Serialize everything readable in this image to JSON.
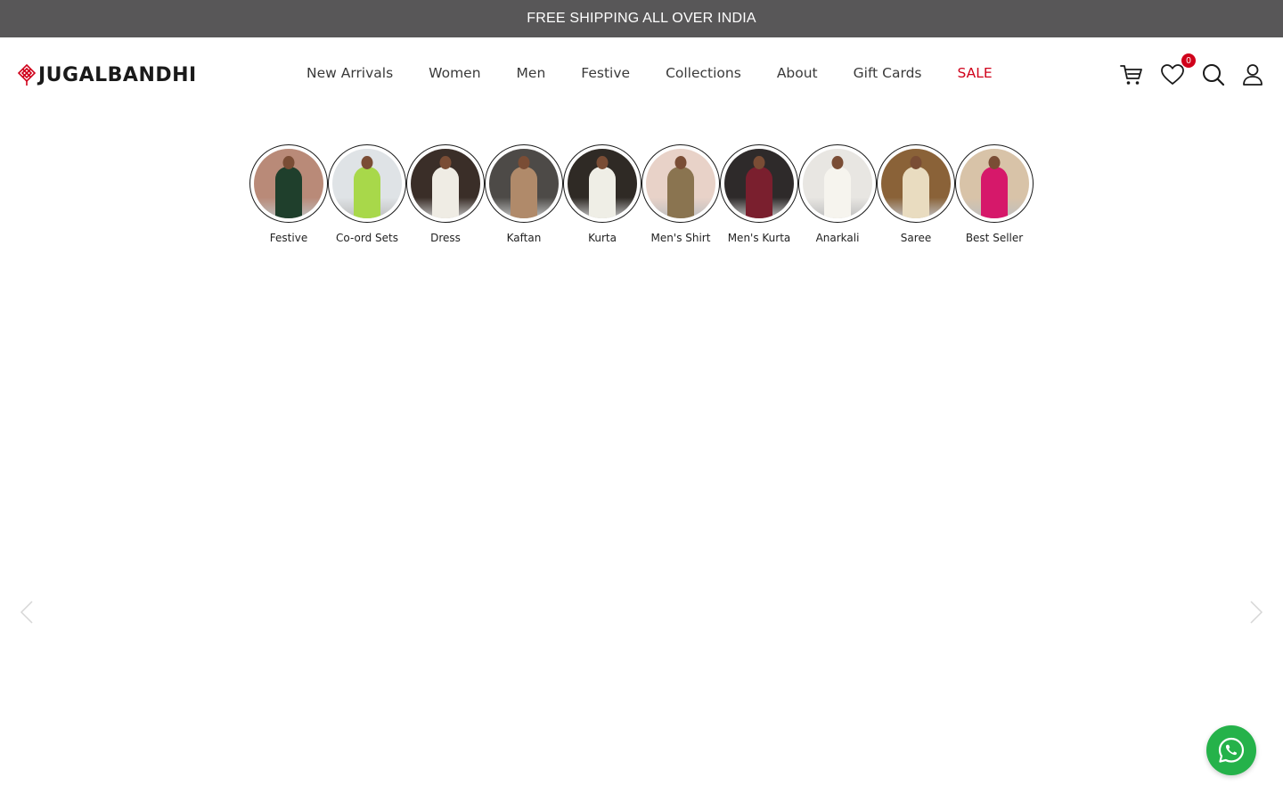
{
  "announcement": {
    "text": "FREE SHIPPING ALL OVER INDIA"
  },
  "brand": {
    "name": "JUGALBANDHI",
    "accent": "#d0021b"
  },
  "nav": {
    "items": [
      {
        "label": "New Arrivals"
      },
      {
        "label": "Women"
      },
      {
        "label": "Men"
      },
      {
        "label": "Festive"
      },
      {
        "label": "Collections"
      },
      {
        "label": "About"
      },
      {
        "label": "Gift Cards"
      },
      {
        "label": "SALE"
      }
    ]
  },
  "header_icons": {
    "cart": "cart-icon",
    "wishlist": "heart-icon",
    "wishlist_count": "0",
    "search": "search-icon",
    "account": "user-icon"
  },
  "categories": [
    {
      "label": "Festive",
      "bg": "#b98a78",
      "dress": "#1f3f2c"
    },
    {
      "label": "Co-ord Sets",
      "bg": "#dfe3e6",
      "dress": "#a8d84a"
    },
    {
      "label": "Dress",
      "bg": "#3a2e28",
      "dress": "#efece4"
    },
    {
      "label": "Kaftan",
      "bg": "#4d4a47",
      "dress": "#b08a6a"
    },
    {
      "label": "Kurta",
      "bg": "#2f2a25",
      "dress": "#efeee6"
    },
    {
      "label": "Men's Shirt",
      "bg": "#e8d2c8",
      "dress": "#8a7450"
    },
    {
      "label": "Men's Kurta",
      "bg": "#2e2a2a",
      "dress": "#7a1f2e"
    },
    {
      "label": "Anarkali",
      "bg": "#e8e6e2",
      "dress": "#f6f4ee"
    },
    {
      "label": "Saree",
      "bg": "#8a6238",
      "dress": "#e9dcc0"
    },
    {
      "label": "Best Seller",
      "bg": "#d8c3a8",
      "dress": "#d6186a"
    }
  ],
  "carousel": {
    "prev": "chevron-left-icon",
    "next": "chevron-right-icon"
  },
  "chat": {
    "icon": "whatsapp-icon",
    "color": "#25b24a"
  }
}
